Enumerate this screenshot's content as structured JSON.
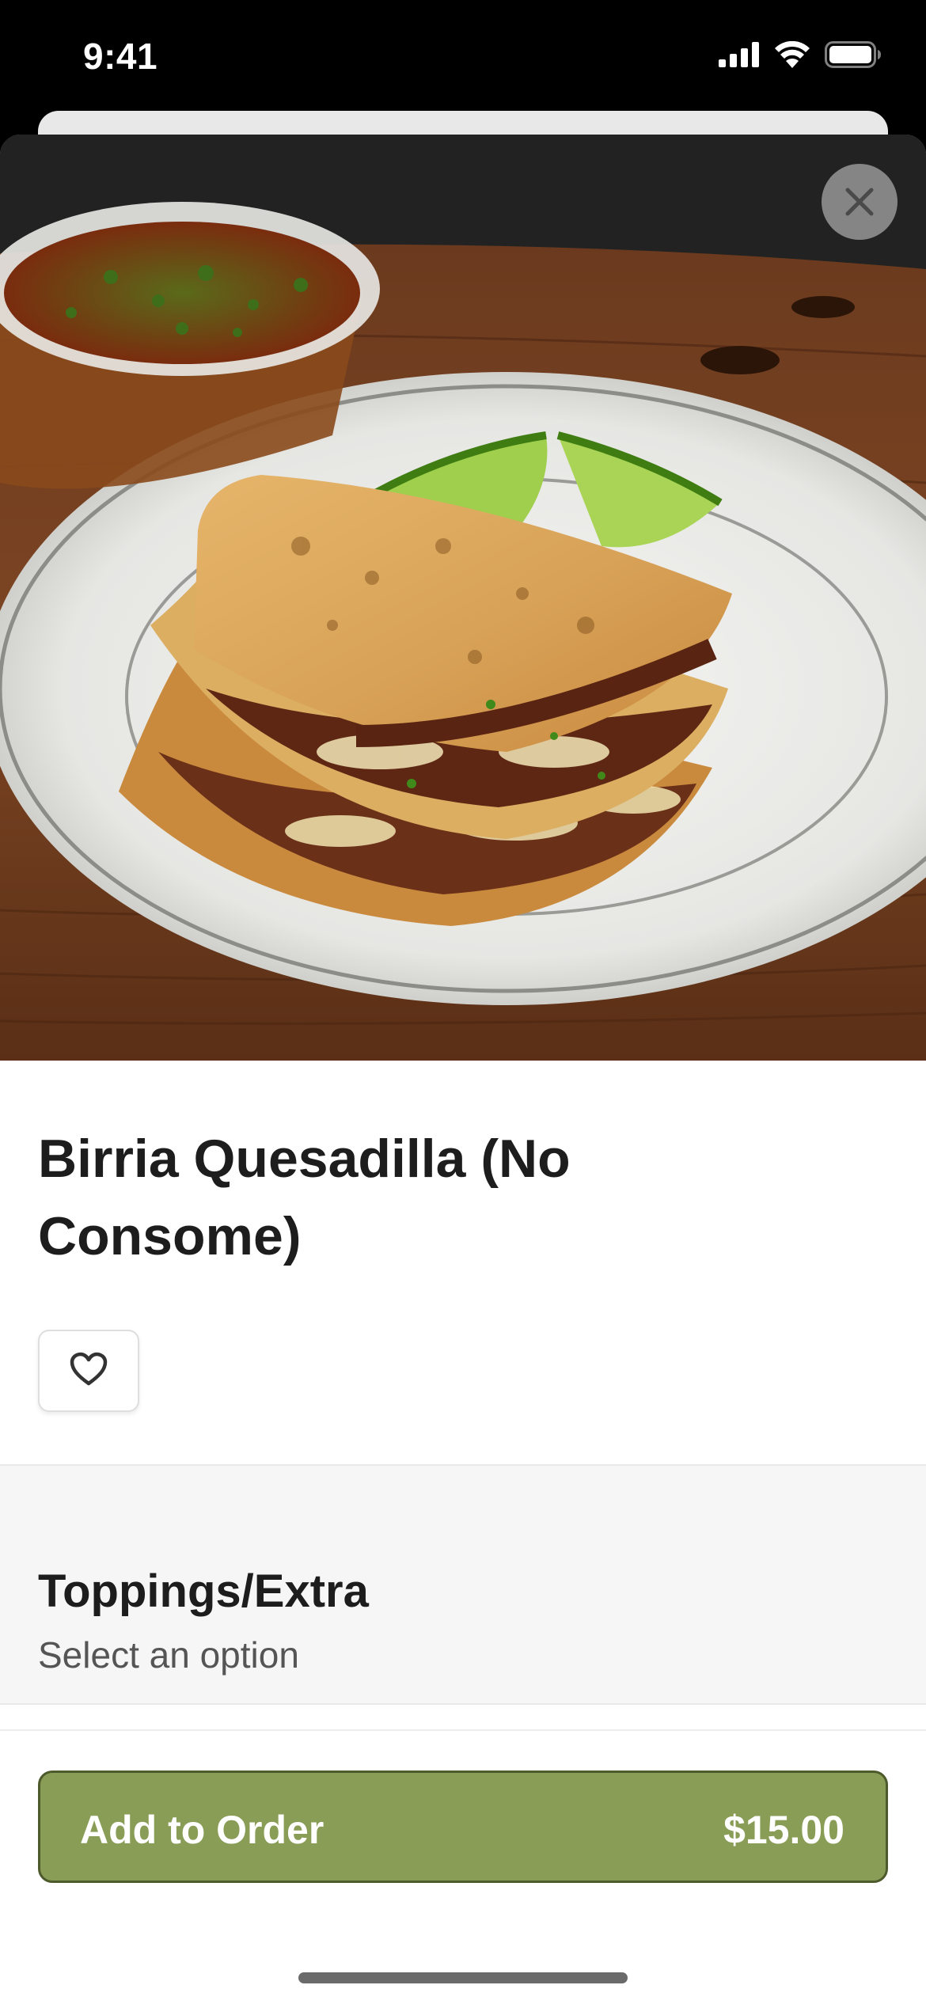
{
  "status_bar": {
    "time": "9:41",
    "icons": [
      "cellular-signal-icon",
      "wifi-icon",
      "battery-icon"
    ]
  },
  "item": {
    "title": "Birria Quesadilla (No Consome)",
    "image_alt": "Birria quesadilla on a plate with lime wedges and a cup of consome"
  },
  "actions": {
    "close_icon": "close-icon",
    "favorite_icon": "heart-icon"
  },
  "options": {
    "title": "Toppings/Extra",
    "subtitle": "Select an option"
  },
  "add_to_order": {
    "label": "Add to Order",
    "price": "$15.00"
  },
  "colors": {
    "accent": "#8a9d57",
    "accent_border": "#4d5a2b",
    "section_bg": "#f6f6f6"
  }
}
